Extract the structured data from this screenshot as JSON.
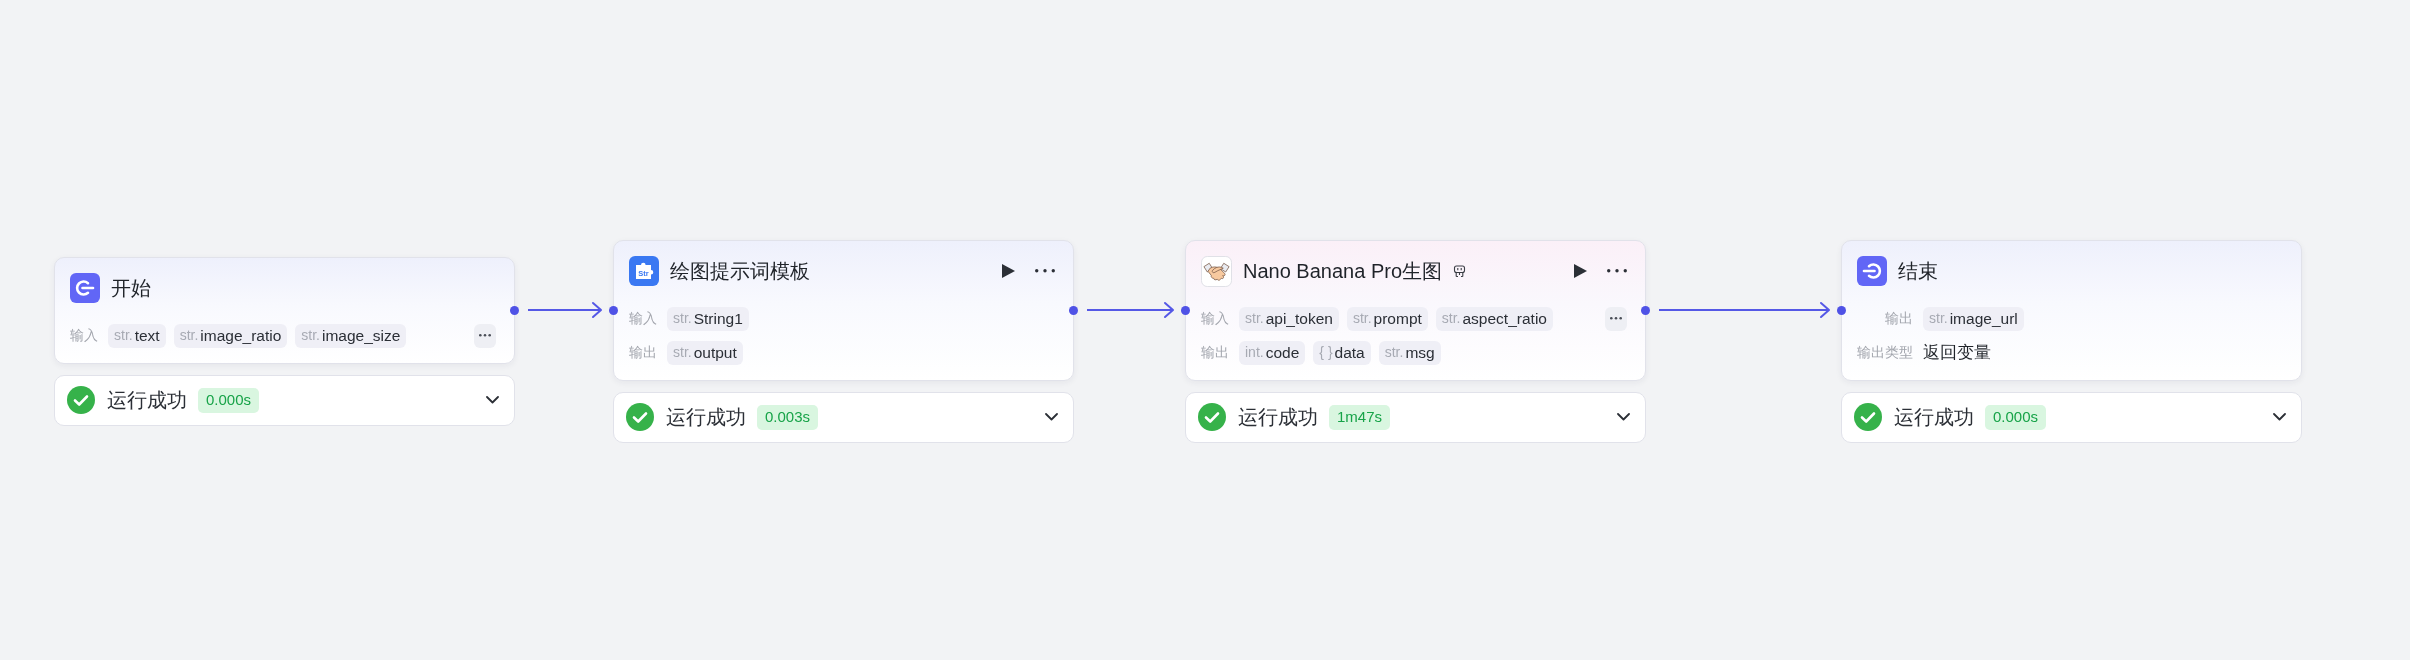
{
  "canvas": {
    "nodes": [
      {
        "kind": "start",
        "title": "开始",
        "badge": false,
        "run_button": false,
        "menu_button": false,
        "rows": [
          {
            "kind": "tags",
            "label": "输入",
            "tags": [
              {
                "type": "str.",
                "name": "text"
              },
              {
                "type": "str.",
                "name": "image_ratio"
              },
              {
                "type": "str.",
                "name": "image_size"
              }
            ],
            "more": true
          }
        ],
        "status": {
          "success": true,
          "text": "运行成功",
          "duration": "0.000s",
          "expanded": false
        }
      },
      {
        "kind": "template",
        "icon_text": "Str",
        "title": "绘图提示词模板",
        "badge": false,
        "run_button": true,
        "menu_button": true,
        "rows": [
          {
            "kind": "tags",
            "label": "输入",
            "tags": [
              {
                "type": "str.",
                "name": "String1"
              }
            ],
            "more": false
          },
          {
            "kind": "tags",
            "label": "输出",
            "tags": [
              {
                "type": "str.",
                "name": "output"
              }
            ],
            "more": false
          }
        ],
        "status": {
          "success": true,
          "text": "运行成功",
          "duration": "0.003s",
          "expanded": false
        }
      },
      {
        "kind": "plugin",
        "title": "Nano Banana Pro生图",
        "badge": true,
        "run_button": true,
        "menu_button": true,
        "rows": [
          {
            "kind": "tags",
            "label": "输入",
            "tags": [
              {
                "type": "str.",
                "name": "api_token"
              },
              {
                "type": "str.",
                "name": "prompt"
              },
              {
                "type": "str.",
                "name": "aspect_ratio"
              }
            ],
            "more": true
          },
          {
            "kind": "tags",
            "label": "输出",
            "tags": [
              {
                "type": "int.",
                "name": "code"
              },
              {
                "type": "{ }",
                "name": "data"
              },
              {
                "type": "str.",
                "name": "msg"
              }
            ],
            "more": false
          }
        ],
        "status": {
          "success": true,
          "text": "运行成功",
          "duration": "1m47s",
          "expanded": false
        }
      },
      {
        "kind": "end",
        "title": "结束",
        "badge": false,
        "run_button": false,
        "menu_button": false,
        "rows": [
          {
            "kind": "tags",
            "label": "输出",
            "tags": [
              {
                "type": "str.",
                "name": "image_url"
              }
            ],
            "more": false
          },
          {
            "kind": "text",
            "label": "输出类型",
            "value": "返回变量",
            "more": false
          }
        ],
        "status": {
          "success": true,
          "text": "运行成功",
          "duration": "0.000s",
          "expanded": false
        }
      }
    ]
  }
}
